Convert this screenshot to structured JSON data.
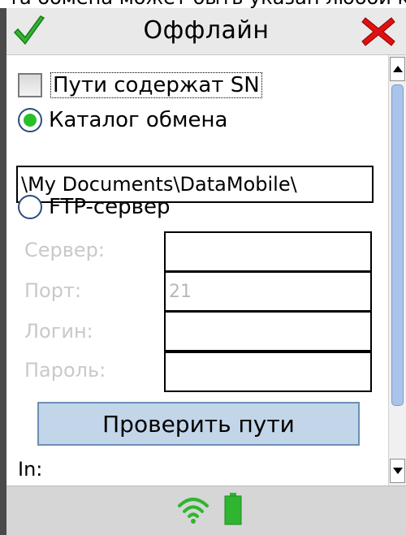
{
  "top_strip": {
    "text": "та обмена может быть указан любой каталог,"
  },
  "window": {
    "title": "Оффлайн",
    "ok_icon": "checkmark-icon",
    "close_icon": "close-x-icon"
  },
  "options": {
    "paths_sn_label": "Пути содержат SN",
    "paths_sn_checked": false,
    "exchange_dir_label": "Каталог обмена",
    "exchange_dir_selected": true,
    "exchange_dir_value": "\\My Documents\\DataMobile\\",
    "ftp_label": "FTP-сервер",
    "ftp_selected": false
  },
  "ftp": {
    "server_label": "Сервер:",
    "server_value": "",
    "port_label": "Порт:",
    "port_value": "21",
    "login_label": "Логин:",
    "login_value": "",
    "password_label": "Пароль:",
    "password_value": ""
  },
  "check_button": "Проверить пути",
  "in_label": "In:",
  "status": {
    "wifi_icon": "wifi-icon",
    "battery_icon": "battery-icon"
  },
  "colors": {
    "radio_dot": "#28c028",
    "button_bg": "#c3d5e9",
    "scroll_thumb": "#a9c3ea",
    "close_red": "#e01010",
    "ok_green": "#2fb52f",
    "status_green": "#2fb52f"
  }
}
